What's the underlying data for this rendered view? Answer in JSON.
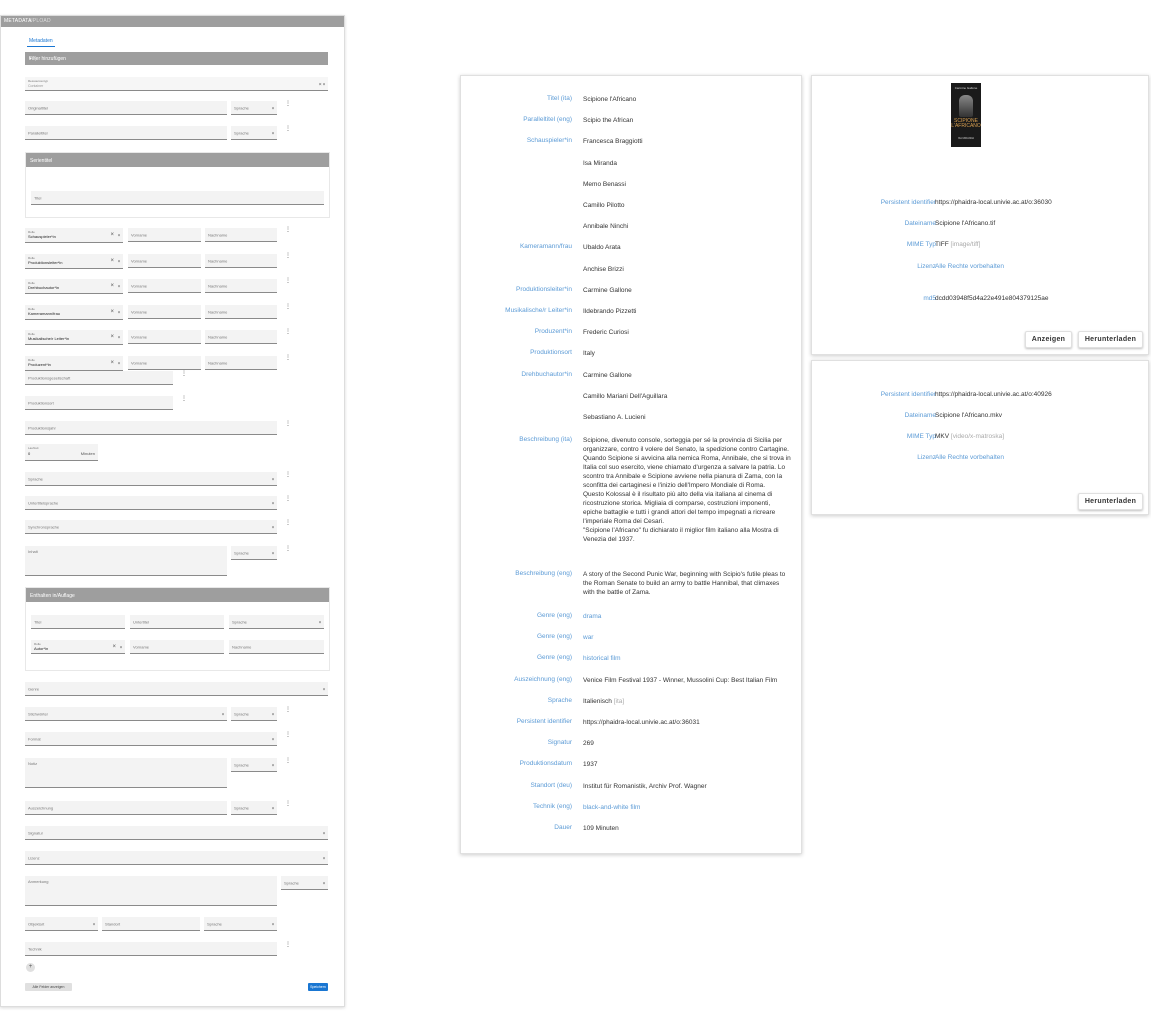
{
  "editor": {
    "topbar": {
      "tab1": "METADATA",
      "tab2": "UPLOAD"
    },
    "tab_label": "Metadaten",
    "filter_header": "Filter hinzufügen",
    "resource_type": {
      "label": "Ressourcentyp",
      "value": "Container"
    },
    "original_title": "Originaltitel",
    "parallel_title": "Paralleltitel",
    "language_label": "Sprache",
    "series_header": "Serientitel",
    "title_label": "Titel",
    "role_label": "Rolle",
    "firstname_label": "Vorname",
    "lastname_label": "Nachname",
    "roles": [
      "Schauspieler*in",
      "Produktionsleiter*in",
      "Drehbuchautor*in",
      "Kameramann/frau",
      "Musikalische/r Leiter*in",
      "Produzent*in"
    ],
    "production_company": "Produktionsgesellschaft",
    "production_place": "Produktionsort",
    "production_date": "Produktionsjahr",
    "duration": {
      "label": "Laufzeit",
      "value": "0",
      "unit": "Minuten"
    },
    "language": "Sprache",
    "subtitle_language": "Untertitelsprache",
    "dubbed_language": "Synchronsprache",
    "description_label": "Inhalt",
    "publication_header": "Enthalten in/Auflage",
    "publication_title": "Titel",
    "pub_subtitle": "Untertitel",
    "pub_role": "Autor*in",
    "genre": "Genre",
    "keywords": "Stichwörter",
    "format": "Format",
    "notes": "Notiz",
    "award": "Auszeichnung",
    "inventory": "Signatur",
    "license": "Lizenz",
    "rights": "Anmerkung",
    "object_type": "Objektart",
    "location": "Standort",
    "technique": "Technik",
    "fields_button": "Alle Felder anzeigen",
    "save_button": "Speichern"
  },
  "metadata": [
    {
      "key": "Titel (ita)",
      "vals": [
        "Scipione l'Africano"
      ]
    },
    {
      "key": "Paralleltitel (eng)",
      "vals": [
        "Scipio the African"
      ]
    },
    {
      "key": "Schauspieler*in",
      "vals": [
        "Francesca Braggiotti"
      ]
    },
    {
      "key": "",
      "vals": [
        "Isa Miranda"
      ]
    },
    {
      "key": "",
      "vals": [
        "Memo Benassi"
      ]
    },
    {
      "key": "",
      "vals": [
        "Camillo Pilotto"
      ]
    },
    {
      "key": "",
      "vals": [
        "Annibale Ninchi"
      ]
    },
    {
      "key": "Kameramann/frau",
      "vals": [
        "Ubaldo Arata"
      ]
    },
    {
      "key": "",
      "vals": [
        "Anchise Brizzi"
      ]
    },
    {
      "key": "Produktionsleiter*in",
      "vals": [
        "Carmine Gallone"
      ]
    },
    {
      "key": "Musikalische/r Leiter*in",
      "vals": [
        "Ildebrando Pizzetti"
      ]
    },
    {
      "key": "Produzent*in",
      "vals": [
        "Frederic Curiosi"
      ]
    },
    {
      "key": "Produktionsort",
      "vals": [
        "Italy"
      ]
    },
    {
      "key": "Drehbuchautor*in",
      "vals": [
        "Carmine Gallone"
      ]
    },
    {
      "key": "",
      "vals": [
        "Camillo Mariani Dell'Aguillara"
      ]
    },
    {
      "key": "",
      "vals": [
        "Sebastiano A. Lucieni"
      ]
    }
  ],
  "description_ita": {
    "key": "Beschreibung (ita)",
    "lines": [
      "Scipione, divenuto console, sorteggia per sé la provincia di Sicilia per",
      "organizzare, contro il volere del Senato, la spedizione contro Cartagine.",
      "Quando Scipione si avvicina alla nemica Roma, Annibale, che si trova in",
      "Italia col suo esercito, viene chiamato d'urgenza a salvare la patria. Lo",
      "scontro tra Annibale e Scipione avviene nella pianura di Zama, con la",
      "sconfitta dei cartaginesi e l'inizio dell'Impero Mondiale di Roma.",
      "Questo Kolossal è il risultato più alto della via italiana al cinema di",
      "ricostruzione storica. Migliaia di comparse, costruzioni imponenti,",
      "epiche battaglie e tutti i grandi attori del tempo impegnati a ricreare",
      "l'imperiale Roma dei Cesari.",
      "\"Scipione l'Africano\" fu dichiarato il miglior film italiano alla Mostra di",
      "Venezia del 1937."
    ]
  },
  "description_eng": {
    "key": "Beschreibung (eng)",
    "lines": [
      "A story of the Second Punic War, beginning with Scipio's futile pleas to",
      "the Roman Senate to build an army to battle Hannibal, that climaxes",
      "with the battle of Zama."
    ]
  },
  "metadata2": [
    {
      "key": "Genre (eng)",
      "val": "drama",
      "link": true
    },
    {
      "key": "Genre (eng)",
      "val": "war",
      "link": true
    },
    {
      "key": "Genre (eng)",
      "val": "historical film",
      "link": true
    },
    {
      "key": "Auszeichnung (eng)",
      "val": "Venice Film Festival 1937 - Winner, Mussolini Cup: Best Italian Film",
      "link": false
    },
    {
      "key": "Sprache",
      "val": "Italienisch",
      "extra": "[ita]",
      "link": false
    },
    {
      "key": "Persistent identifier",
      "val": "https://phaidra-local.univie.ac.at/o:36031",
      "link": false
    },
    {
      "key": "Signatur",
      "val": "269",
      "link": false
    },
    {
      "key": "Produktionsdatum",
      "val": "1937",
      "link": false
    },
    {
      "key": "Standort (deu)",
      "val": "Institut für Romanistik, Archiv Prof. Wagner",
      "link": false
    },
    {
      "key": "Technik (eng)",
      "val": "black-and-white film",
      "link": true
    },
    {
      "key": "Dauer",
      "val": "109 Minuten",
      "link": false
    }
  ],
  "file1": {
    "cover": {
      "top": "Carmine Gallone",
      "title": "SCIPIONE L'AFRICANO",
      "bottom": "ISA MIRANDA"
    },
    "rows": [
      {
        "key": "Persistent identifier",
        "val": "https://phaidra-local.univie.ac.at/o:36030"
      },
      {
        "key": "Dateiname",
        "val": "Scipione l'Africano.tif"
      },
      {
        "key": "MIME Typ",
        "val": "TIFF",
        "extra": "[image/tiff]"
      },
      {
        "key": "Lizenz",
        "val": "Alle Rechte vorbehalten",
        "link": true
      },
      {
        "key": "md5",
        "val": "dcdd03948f5d4a22e491e8043791​25ae"
      }
    ],
    "show_button": "Anzeigen",
    "download_button": "Herunterladen"
  },
  "file2": {
    "rows": [
      {
        "key": "Persistent identifier",
        "val": "https://phaidra-local.univie.ac.at/o:40926"
      },
      {
        "key": "Dateiname",
        "val": "Scipione l'Africano.mkv"
      },
      {
        "key": "MIME Typ",
        "val": "MKV",
        "extra": "[video/x-matroska]"
      },
      {
        "key": "Lizenz",
        "val": "Alle Rechte vorbehalten",
        "link": true
      }
    ],
    "download_button": "Herunterladen"
  }
}
